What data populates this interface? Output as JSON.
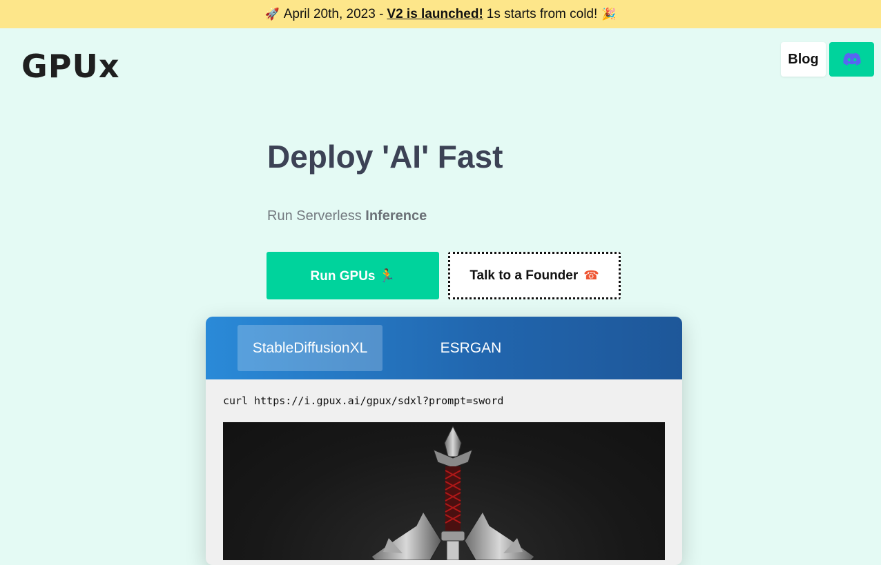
{
  "banner": {
    "rocket_icon": "rocket-icon",
    "date_text": "April 20th, 2023 -",
    "link_text": "V2 is launched!",
    "after_text": "1s starts from cold!",
    "party_icon": "party-popper-icon"
  },
  "header": {
    "logo_text": "GPUx",
    "blog_label": "Blog",
    "discord_icon": "discord-icon"
  },
  "hero": {
    "title": "Deploy 'AI' Fast",
    "subtitle_prefix": "Run Serverless",
    "subtitle_bold": "Inference",
    "primary_button": "Run GPUs 🏃",
    "secondary_button": "Talk to a Founder",
    "secondary_icon": "☎"
  },
  "demo": {
    "tabs": [
      {
        "label": "StableDiffusionXL",
        "active": true
      },
      {
        "label": "ESRGAN",
        "active": false
      }
    ],
    "curl_command": "curl https://i.gpux.ai/gpux/sdxl?prompt=sword",
    "image_subject": "sword-image"
  },
  "colors": {
    "background": "#e4faf4",
    "banner": "#fde68a",
    "accent": "#00d39c",
    "tab_gradient_start": "#2a8ad8",
    "tab_gradient_end": "#1e5799"
  }
}
